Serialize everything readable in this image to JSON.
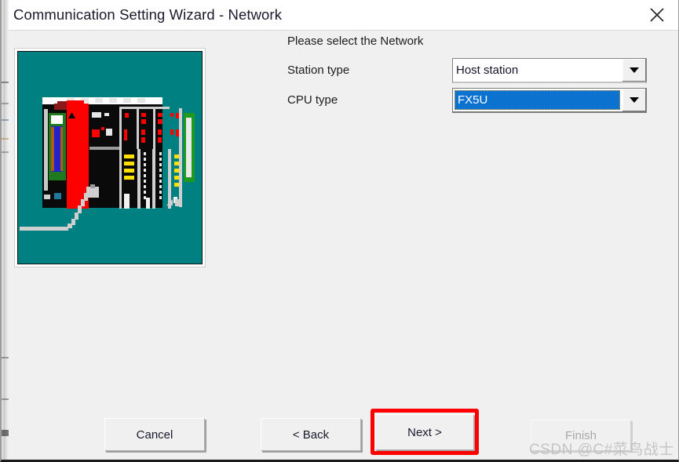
{
  "window": {
    "title": "Communication Setting Wizard - Network",
    "close_icon": "close-icon"
  },
  "illustration": {
    "alt": "plc-rack-illustration",
    "background_color": "#008080"
  },
  "form": {
    "prompt": "Please select the Network",
    "rows": [
      {
        "label": "Station type",
        "value": "Host station",
        "focused": false,
        "arrow_icon": "chevron-down-icon"
      },
      {
        "label": "CPU type",
        "value": "FX5U",
        "focused": true,
        "arrow_icon": "chevron-down-icon"
      }
    ]
  },
  "footer": {
    "cancel_label": "Cancel",
    "back_label": "< Back",
    "next_label": "Next >",
    "finish_label": "Finish",
    "finish_enabled": false,
    "highlight_color": "#ff0000"
  },
  "watermark": {
    "text": "CSDN @C#菜鸟战士"
  },
  "colors": {
    "selection_blue": "#0c72d0",
    "illustration_teal": "#008080",
    "annotation_red": "#ff0000",
    "window_background": "#f0f0f0",
    "titlebar_background": "#ffffff"
  }
}
